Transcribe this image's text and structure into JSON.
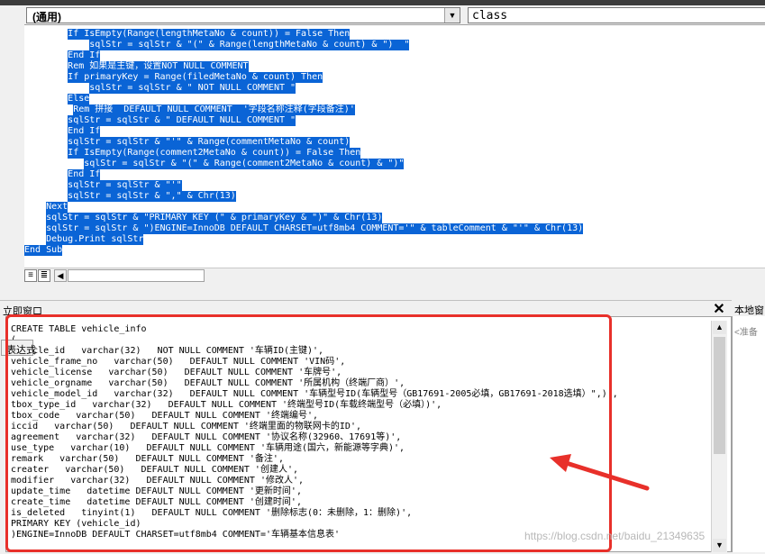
{
  "editor": {
    "object_combo": "(通用)",
    "proc_combo": "class",
    "code_lines": [
      {
        "indent": "        ",
        "text": "If IsEmpty(Range(lengthMetaNo & count)) = False Then"
      },
      {
        "indent": "            ",
        "text": "sqlStr = sqlStr & \"(\" & Range(lengthMetaNo & count) & \")  \""
      },
      {
        "indent": "        ",
        "text": "End If"
      },
      {
        "indent": "        ",
        "text": "Rem 如果是主键，设置NOT NULL COMMENT"
      },
      {
        "indent": "        ",
        "text": "If primaryKey = Range(filedMetaNo & count) Then"
      },
      {
        "indent": "            ",
        "text": "sqlStr = sqlStr & \" NOT NULL COMMENT \""
      },
      {
        "indent": "        ",
        "text": "Else"
      },
      {
        "indent": "         ",
        "text": "Rem 拼接  DEFAULT NULL COMMENT  '字段名称注释(字段备注)'"
      },
      {
        "indent": "        ",
        "text": "sqlStr = sqlStr & \" DEFAULT NULL COMMENT \""
      },
      {
        "indent": "        ",
        "text": "End If"
      },
      {
        "indent": "        ",
        "text": "sqlStr = sqlStr & \"'\" & Range(commentMetaNo & count)"
      },
      {
        "indent": "        ",
        "text": "If IsEmpty(Range(comment2MetaNo & count)) = False Then"
      },
      {
        "indent": "           ",
        "text": "sqlStr = sqlStr & \"(\" & Range(comment2MetaNo & count) & \")\""
      },
      {
        "indent": "        ",
        "text": "End If"
      },
      {
        "indent": "        ",
        "text": "sqlStr = sqlStr & \"'\""
      },
      {
        "indent": "        ",
        "text": "sqlStr = sqlStr & \",\" & Chr(13)"
      },
      {
        "indent": "    ",
        "text": "Next"
      },
      {
        "indent": "    ",
        "text": "sqlStr = sqlStr & \"PRIMARY KEY (\" & primaryKey & \")\" & Chr(13)"
      },
      {
        "indent": "    ",
        "text": "sqlStr = sqlStr & \")ENGINE=InnoDB DEFAULT CHARSET=utf8mb4 COMMENT='\" & tableComment & \"'\" & Chr(13)"
      },
      {
        "indent": "    ",
        "text": "Debug.Print sqlStr"
      },
      {
        "indent": "",
        "text": "End Sub"
      }
    ]
  },
  "immediate": {
    "title": "立即窗口",
    "close_glyph": "✕",
    "lines": [
      "CREATE TABLE vehicle_info",
      "(",
      "vehicle_id   varchar(32)   NOT NULL COMMENT '车辆ID(主键)',",
      "vehicle_frame_no   varchar(50)   DEFAULT NULL COMMENT 'VIN码',",
      "vehicle_license   varchar(50)   DEFAULT NULL COMMENT '车牌号',",
      "vehicle_orgname   varchar(50)   DEFAULT NULL COMMENT '所属机构（终端厂商）',",
      "vehicle_model_id   varchar(32)   DEFAULT NULL COMMENT '车辆型号ID(车辆型号（GB17691-2005必填，GB17691-2018选填）\",)',",
      "tbox_type_id   varchar(32)   DEFAULT NULL COMMENT '终端型号ID(车载终端型号（必填）)',",
      "tbox_code   varchar(50)   DEFAULT NULL COMMENT '终端编号',",
      "iccid   varchar(50)   DEFAULT NULL COMMENT '终端里面的物联网卡的ID',",
      "agreement   varchar(32)   DEFAULT NULL COMMENT '协议名称(32960、17691等)',",
      "use_type   varchar(10)   DEFAULT NULL COMMENT '车辆用途(国六，新能源等字典)',",
      "remark   varchar(50)   DEFAULT NULL COMMENT '备注',",
      "creater   varchar(50)   DEFAULT NULL COMMENT '创建人',",
      "modifier   varchar(32)   DEFAULT NULL COMMENT '修改人',",
      "update_time   datetime DEFAULT NULL COMMENT '更新时间',",
      "create_time   datetime DEFAULT NULL COMMENT '创建时间',",
      "is_deleted   tinyint(1)   DEFAULT NULL COMMENT '删除标志(0：未删除，1：删除)',",
      "PRIMARY KEY (vehicle_id)",
      ")ENGINE=InnoDB DEFAULT CHARSET=utf8mb4 COMMENT='车辆基本信息表'"
    ]
  },
  "locals": {
    "title": "本地窗口",
    "ready_text": "<准备",
    "expression_header": "表达式"
  },
  "watermark": "https://blog.csdn.net/baidu_21349635",
  "colors": {
    "selection": "#0a64d6",
    "highlight_box": "#e8302a"
  }
}
